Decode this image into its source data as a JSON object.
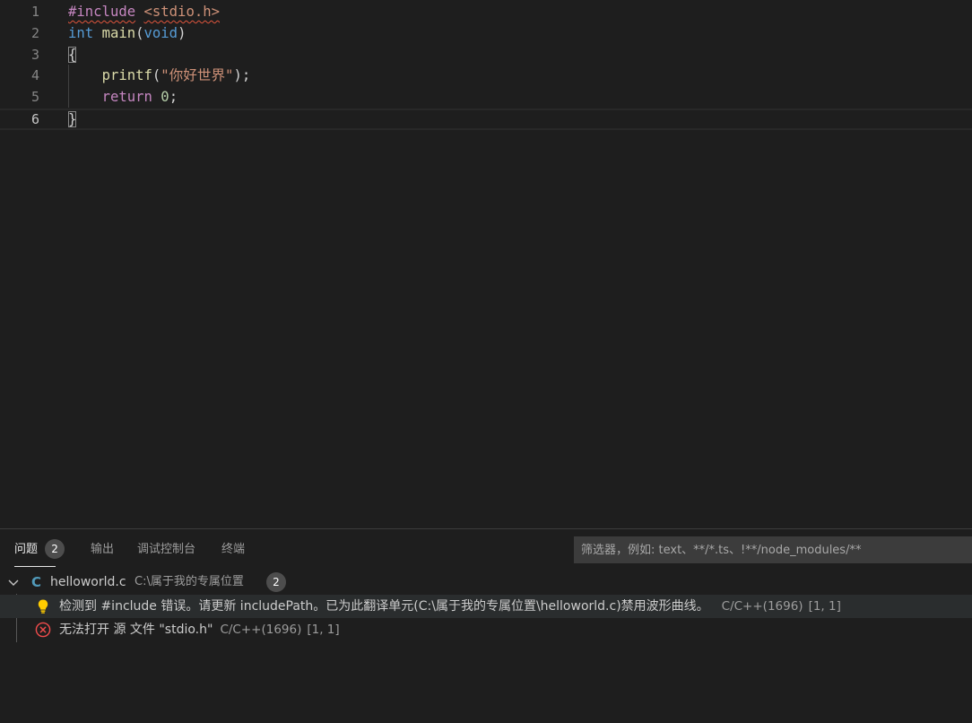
{
  "editor": {
    "lines": [
      {
        "num": "1",
        "t1": "#include",
        "t2": "<stdio.h>"
      },
      {
        "num": "2",
        "kw": "int",
        "fn": "main",
        "p1": "(",
        "kw2": "void",
        "p2": ")"
      },
      {
        "num": "3",
        "brace": "{"
      },
      {
        "num": "4",
        "fn": "printf",
        "p1": "(",
        "str": "\"你好世界\"",
        "p2": ");"
      },
      {
        "num": "5",
        "ctl": "return",
        "num_lit": "0",
        "semi": ";"
      },
      {
        "num": "6",
        "brace": "}"
      }
    ]
  },
  "panel": {
    "tabs": [
      {
        "label": "问题",
        "badge": "2"
      },
      {
        "label": "输出"
      },
      {
        "label": "调试控制台"
      },
      {
        "label": "终端"
      }
    ],
    "filter_placeholder": "筛选器，例如: text、**/*.ts、!**/node_modules/**",
    "file": {
      "icon": "C",
      "name": "helloworld.c",
      "path": "C:\\属于我的专属位置",
      "count": "2"
    },
    "problems": [
      {
        "icon": "lightbulb-icon",
        "text": "检测到 #include 错误。请更新 includePath。已为此翻译单元(C:\\属于我的专属位置\\helloworld.c)禁用波形曲线。",
        "source": "C/C++(1696)",
        "position": "[1, 1]"
      },
      {
        "icon": "error-circle-icon",
        "text": "无法打开 源 文件 \"stdio.h\"",
        "source": "C/C++(1696)",
        "position": "[1, 1]"
      }
    ]
  },
  "colors": {
    "background": "#1e1e1e",
    "keyword": "#569cd6",
    "function": "#dcdcaa",
    "string": "#ce9178",
    "control": "#c586c0",
    "number": "#b5cea8",
    "error": "#f14c4c",
    "warning": "#ffcc00"
  }
}
